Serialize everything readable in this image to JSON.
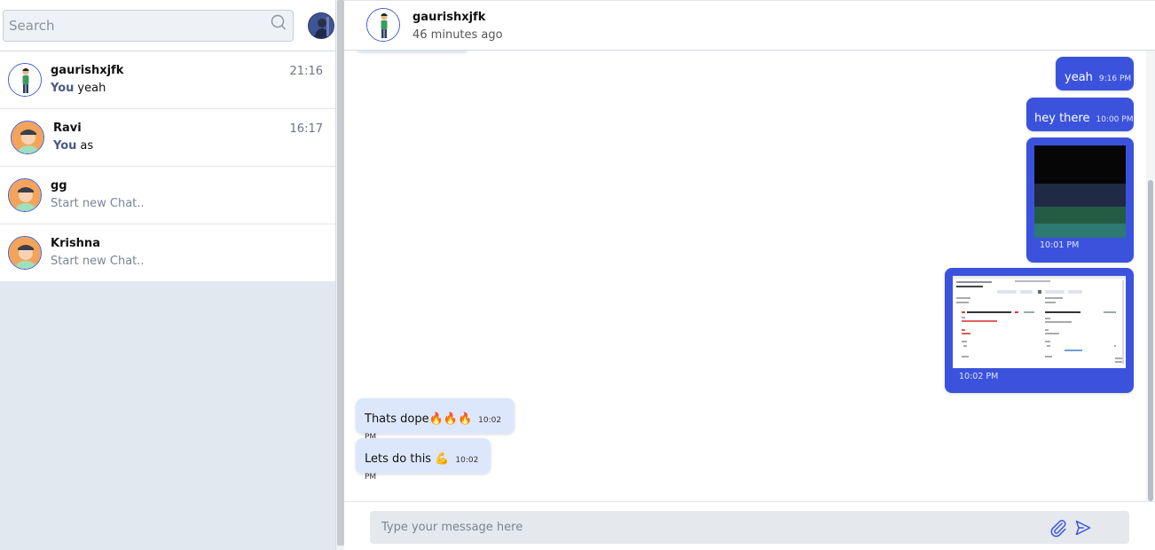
{
  "sidebar": {
    "search_placeholder": "Search",
    "chats": [
      {
        "name": "gaurishxjfk",
        "time": "21:16",
        "you_label": "You",
        "preview": "yeah",
        "avatar": "person-avatar"
      },
      {
        "name": "Ravi",
        "time": "16:17",
        "you_label": "You",
        "preview": "as",
        "avatar": "default-avatar"
      },
      {
        "name": "gg",
        "time": "",
        "you_label": "",
        "preview": "Start new Chat..",
        "avatar": "default-avatar"
      },
      {
        "name": "Krishna",
        "time": "",
        "you_label": "",
        "preview": "Start new Chat..",
        "avatar": "default-avatar"
      }
    ]
  },
  "header": {
    "name": "gaurishxjfk",
    "status": "46 minutes ago"
  },
  "messages": [
    {
      "direction": "out",
      "type": "text",
      "text": "yeah",
      "time": "9:16 PM"
    },
    {
      "direction": "out",
      "type": "text",
      "text": "hey there",
      "time": "10:00 PM"
    },
    {
      "direction": "out",
      "type": "image",
      "image": "color-bands-image",
      "time": "10:01 PM"
    },
    {
      "direction": "out",
      "type": "image",
      "image": "screenshot-image",
      "time": "10:02 PM"
    },
    {
      "direction": "in",
      "type": "text",
      "text": "Thats dope🔥🔥🔥",
      "time": "10:02 PM"
    },
    {
      "direction": "in",
      "type": "text",
      "text": "Lets do this 💪",
      "time": "10:02 PM"
    }
  ],
  "composer": {
    "placeholder": "Type your message here"
  },
  "colors": {
    "outgoing_bubble": "#3b53dc",
    "incoming_bubble": "#dde7fb",
    "sidebar_bg": "#e2e8f0"
  }
}
